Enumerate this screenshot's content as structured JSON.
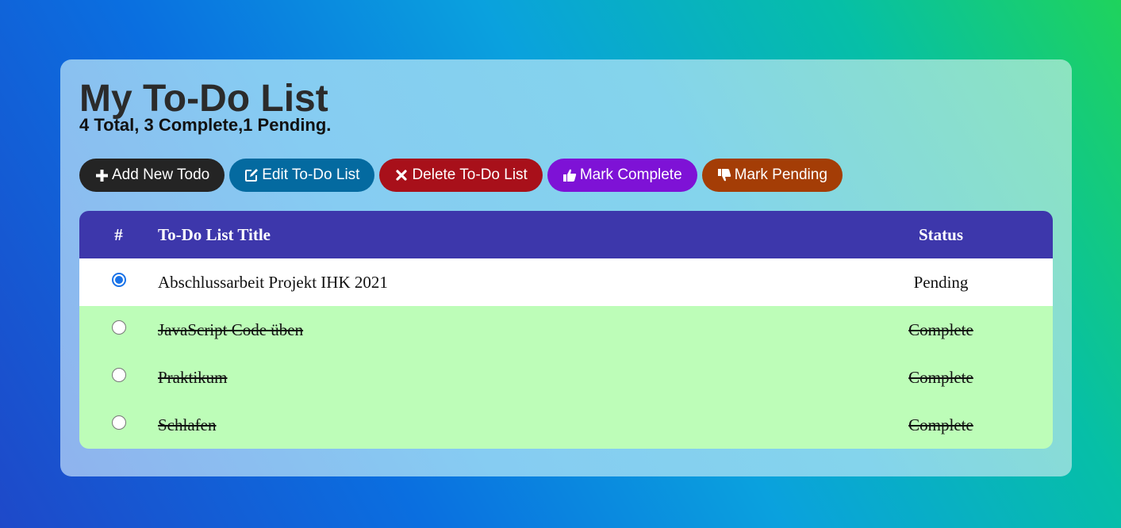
{
  "header": {
    "title": "My To-Do List",
    "summary": "4 Total, 3 Complete,1 Pending."
  },
  "toolbar": {
    "add_label": "Add New Todo",
    "edit_label": "Edit To-Do List",
    "delete_label": "Delete To-Do List",
    "complete_label": "Mark Complete",
    "pending_label": "Mark Pending",
    "icons": [
      "plus-icon",
      "edit-icon",
      "close-icon",
      "thumbs-up-icon",
      "thumbs-down-icon"
    ]
  },
  "table": {
    "columns": [
      "#",
      "To-Do List Title",
      "Status"
    ],
    "rows": [
      {
        "title": "Abschlussarbeit Projekt IHK 2021",
        "status": "Pending",
        "selected": true
      },
      {
        "title": "JavaScript Code üben",
        "status": "Complete",
        "selected": false
      },
      {
        "title": "Praktikum",
        "status": "Complete",
        "selected": false
      },
      {
        "title": "Schlafen",
        "status": "Complete",
        "selected": false
      }
    ]
  },
  "colors": {
    "header_bg": "#3d37ab",
    "complete_row_bg": "#bdfdb8",
    "pending_row_bg": "#ffffff",
    "add_btn": "#242424",
    "edit_btn": "#046aa0",
    "delete_btn": "#a8101a",
    "complete_btn": "#7e12d6",
    "pending_btn": "#a43d06"
  }
}
